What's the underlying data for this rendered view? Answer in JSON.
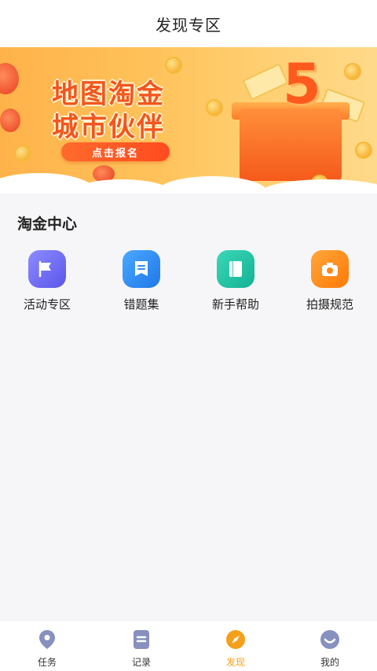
{
  "header": {
    "title": "发现专区"
  },
  "banner": {
    "line1": "地图淘金",
    "line2": "城市伙伴",
    "cta_label": "点击报名",
    "badge_number": "5"
  },
  "section": {
    "title": "淘金中心",
    "items": [
      {
        "label": "活动专区",
        "icon": "flag-icon",
        "color": "#6a6cf6"
      },
      {
        "label": "错题集",
        "icon": "note-icon",
        "color": "#2f8ff2"
      },
      {
        "label": "新手帮助",
        "icon": "book-icon",
        "color": "#20c5a6"
      },
      {
        "label": "拍摄规范",
        "icon": "camera-icon",
        "color": "#ff8a14"
      }
    ]
  },
  "tabbar": {
    "items": [
      {
        "label": "任务",
        "icon": "location-pin-icon",
        "active": false
      },
      {
        "label": "记录",
        "icon": "list-icon",
        "active": false
      },
      {
        "label": "发现",
        "icon": "compass-icon",
        "active": true
      },
      {
        "label": "我的",
        "icon": "profile-icon",
        "active": false
      }
    ],
    "active_color": "#f4a01a",
    "inactive_icon_color": "#7f8ab8"
  }
}
